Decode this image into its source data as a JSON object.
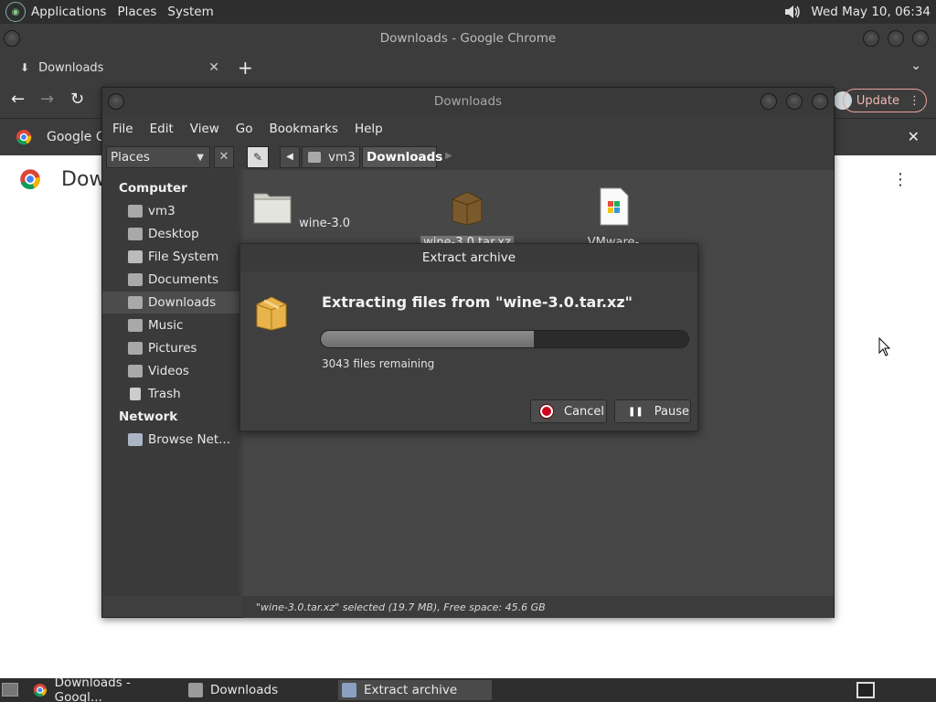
{
  "top_panel": {
    "menus": [
      "Applications",
      "Places",
      "System"
    ],
    "clock": "Wed May 10, 06:34"
  },
  "chrome": {
    "window_title": "Downloads - Google Chrome",
    "tab_label": "Downloads",
    "update_label": "Update",
    "bookmark_text": "Google C",
    "page_title": "Dow"
  },
  "file_manager": {
    "window_title": "Downloads",
    "menu": [
      "File",
      "Edit",
      "View",
      "Go",
      "Bookmarks",
      "Help"
    ],
    "places_label": "Places",
    "breadcrumb": [
      "vm3",
      "Downloads"
    ],
    "sidebar": {
      "computer_header": "Computer",
      "computer_items": [
        "vm3",
        "Desktop",
        "File System",
        "Documents",
        "Downloads",
        "Music",
        "Pictures",
        "Videos",
        "Trash"
      ],
      "network_header": "Network",
      "network_items": [
        "Browse Net..."
      ]
    },
    "files": [
      "wine-3.0",
      "wine-3.0.tar.xz",
      "VMware-workstation-"
    ],
    "status": "\"wine-3.0.tar.xz\" selected (19.7 MB), Free space: 45.6 GB"
  },
  "dialog": {
    "title": "Extract archive",
    "heading": "Extracting files from \"wine-3.0.tar.xz\"",
    "progress": 0.58,
    "remaining": "3043 files remaining",
    "cancel_label": "Cancel",
    "pause_label": "Pause"
  },
  "taskbar": {
    "items": [
      "Downloads - Googl...",
      "Downloads",
      "Extract archive"
    ]
  },
  "colors": {
    "panel": "#2e2e2e",
    "dialog_bg": "#3f3f3f",
    "update_accent": "#f2b8b2",
    "cancel_red": "#d0021b"
  }
}
